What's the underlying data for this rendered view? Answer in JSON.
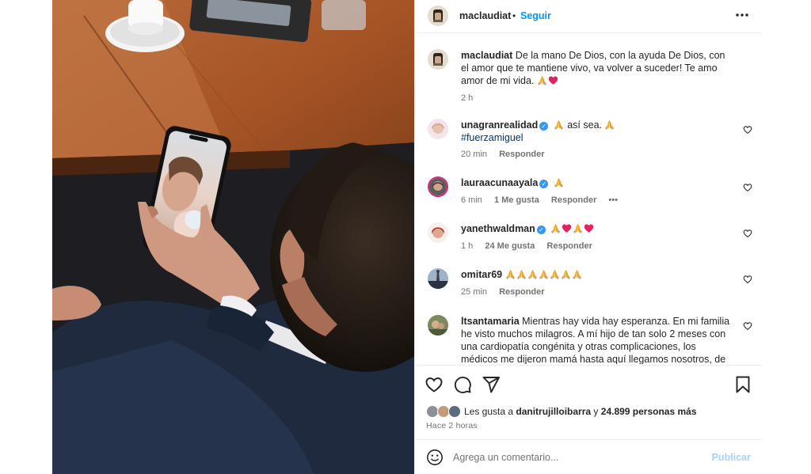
{
  "header": {
    "username": "maclaudiat",
    "separator": "•",
    "follow_label": "Seguir"
  },
  "caption": {
    "username": "maclaudiat",
    "text": "De la mano De Dios, con la ayuda De Dios, con el amor que te mantiene vivo, va volver a suceder! Te amo amor de mi vida.",
    "time": "2 h"
  },
  "comments": [
    {
      "username": "unagranrealidad",
      "verified": true,
      "text": "así sea.",
      "hashtag": "#fuerzamiguel",
      "time": "20 min",
      "likes": "",
      "reply": "Responder"
    },
    {
      "username": "lauraacunaayala",
      "verified": true,
      "text": "",
      "time": "6 min",
      "likes": "1 Me gusta",
      "reply": "Responder",
      "more": "•••"
    },
    {
      "username": "yanethwaldman",
      "verified": true,
      "text": "",
      "time": "1 h",
      "likes": "24 Me gusta",
      "reply": "Responder"
    },
    {
      "username": "omitar69",
      "verified": false,
      "text": "",
      "time": "25 min",
      "likes": "",
      "reply": "Responder"
    },
    {
      "username": "ltsantamaria",
      "verified": false,
      "text": "Mientras hay vida hay esperanza. En mi familia he visto muchos milagros. A mí hijo de tan solo 2 meses con una cardiopatía congénita y otras complicaciones, los médicos me dijeron mamá hasta aquí llegamos nosotros, de esta noche no"
    }
  ],
  "likes": {
    "prefix": "Les gusta a",
    "user": "danitrujilloibarra",
    "connector": "y",
    "count": "24.899 personas más"
  },
  "timestamp": "Hace 2 horas",
  "add_comment": {
    "placeholder": "Agrega un comentario...",
    "publish_label": "Publicar"
  },
  "icons": [
    "more-icon",
    "heart-icon",
    "comment-icon",
    "share-icon",
    "bookmark-icon",
    "smile-icon",
    "verified-icon",
    "pray-emoji",
    "heart-emoji"
  ],
  "colors": {
    "link": "#0095f6",
    "hashtag": "#00376b",
    "secondary_text": "#737373",
    "verified": "#3897f0",
    "publish_disabled": "#a6d3f7",
    "emoji_heart": "#e0245e",
    "emoji_pray": "#f2b33d"
  }
}
